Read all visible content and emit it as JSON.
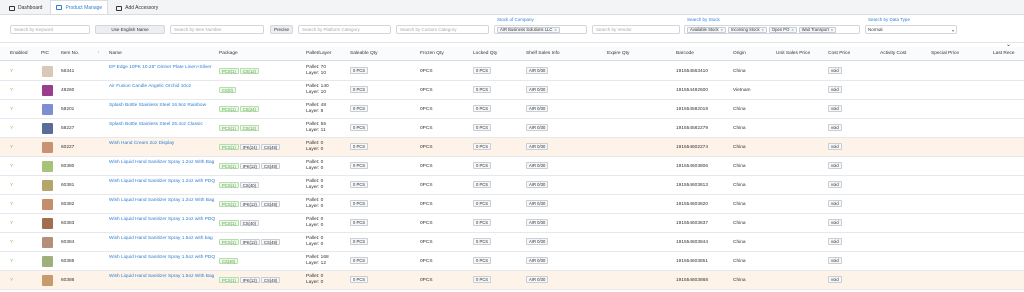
{
  "tabs": [
    {
      "label": "Dashboard",
      "icon": "dashboard-icon"
    },
    {
      "label": "Product Manage",
      "icon": "product-icon",
      "active": true
    },
    {
      "label": "Add Accessory",
      "icon": "accessory-icon"
    }
  ],
  "filters": {
    "keyword_placeholder": "Search by Keyword",
    "use_english_name": "Use English Name",
    "item_number_placeholder": "Search by Item Number",
    "precise": "Precise",
    "platform_category_placeholder": "Search by Platform Category",
    "custom_category_placeholder": "Search by Custom Category",
    "stock_of_company_label": "Stock of Company",
    "stock_of_company_tag": "AIR Business Solutions LLC",
    "vendor_placeholder": "Search by Vendor",
    "search_by_stock_label": "Search by Stock",
    "stock_tags": [
      "Available Stock",
      "Incoming Stock",
      "Open PO",
      "Wait Transport"
    ],
    "data_type_label": "Search by Data Type",
    "data_type_value": "Normal"
  },
  "columns": {
    "enabled": "Enabled",
    "pic": "PIC",
    "item_no": "Item No.",
    "name": "Name",
    "package": "Package",
    "pallet_layer": "Pallet/Layer",
    "saleable_qty": "Saleable Qty",
    "frozen_qty": "Frozen Qty",
    "locked_qty": "Locked Qty",
    "shelf_sales_info": "Shelf Sales Info",
    "expire_qty": "Expire Qty",
    "barcode": "Barcode",
    "origin": "Origin",
    "unit_sales_price": "Unit Sales Price",
    "cost_price": "Cost Price",
    "activity_cost": "Activity Cost",
    "special_price": "Special Price",
    "last_recv": "Last Rece"
  },
  "rows": [
    {
      "enabled": "Y",
      "item_no": "56341",
      "name": "EP Edge 10PK 10.25\" Dinner Plate Linen+Silver",
      "package": [
        [
          "PCS(1)",
          "g"
        ],
        [
          "CS(12)",
          "g"
        ]
      ],
      "pallet": "Pallet: 70",
      "layer": "Layer: 10",
      "saleable": "0 PCS",
      "frozen": "0PCS",
      "locked": "0 PCS",
      "shelf": "AIR 0/30",
      "barcode": "191554563410",
      "origin": "China",
      "cost": "void",
      "pic_color": "#d8c9b6",
      "hl": false
    },
    {
      "enabled": "Y",
      "item_no": "48260",
      "name": "Air Fusion Candle Angelic Orchid 10oz",
      "package": [
        [
          "CS(0)",
          "g"
        ]
      ],
      "pallet": "Pallet: 140",
      "layer": "Layer: 10",
      "saleable": "0 PCS",
      "frozen": "0PCS",
      "locked": "0 PCS",
      "shelf": "AIR 0/30",
      "barcode": "191554482600",
      "origin": "Vietnam",
      "cost": "void",
      "pic_color": "#9b3d8f",
      "hl": false
    },
    {
      "enabled": "Y",
      "item_no": "58201",
      "name": "Splash Bottle Stainless Steel 16.9oz Rainbow",
      "package": [
        [
          "PCS(1)",
          "g"
        ],
        [
          "CS(24)",
          "g"
        ]
      ],
      "pallet": "Pallet: 48",
      "layer": "Layer: 8",
      "saleable": "0 PCS",
      "frozen": "0PCS",
      "locked": "0 PCS",
      "shelf": "AIR 0/30",
      "barcode": "191554582019",
      "origin": "China",
      "cost": "void",
      "pic_color": "#7d8fd0",
      "hl": false
    },
    {
      "enabled": "Y",
      "item_no": "58227",
      "name": "Splash Bottle Stainless Steel 25.4oz Classic",
      "package": [
        [
          "PCS(1)",
          "g"
        ],
        [
          "CS(12)",
          "g"
        ]
      ],
      "pallet": "Pallet: 55",
      "layer": "Layer: 11",
      "saleable": "0 PCS",
      "frozen": "0PCS",
      "locked": "0 PCS",
      "shelf": "AIR 0/30",
      "barcode": "191554582279",
      "origin": "China",
      "cost": "void",
      "pic_color": "#5a6d9a",
      "hl": false
    },
    {
      "enabled": "Y",
      "item_no": "60227",
      "name": "Wish Hand Cream 2oz Display",
      "package": [
        [
          "PCS(1)",
          "g"
        ],
        [
          "IPK(24)",
          "x"
        ],
        [
          "CS(48)",
          "x"
        ]
      ],
      "pallet": "Pallet: 0",
      "layer": "Layer: 0",
      "saleable": "0 PCS",
      "frozen": "0PCS",
      "locked": "0 PCS",
      "shelf": "AIR 0/30",
      "barcode": "191554602274",
      "origin": "China",
      "cost": "void",
      "pic_color": "#c99274",
      "hl": true
    },
    {
      "enabled": "Y",
      "item_no": "60380",
      "name": "Wish Liquid Hand Sanitizer Spray 1.2oz With Bag",
      "package": [
        [
          "PCS(1)",
          "g"
        ],
        [
          "IPK(12)",
          "x"
        ],
        [
          "CS(48)",
          "x"
        ]
      ],
      "pallet": "Pallet: 0",
      "layer": "Layer: 0",
      "saleable": "0 PCS",
      "frozen": "0PCS",
      "locked": "0 PCS",
      "shelf": "AIR 0/30",
      "barcode": "191554603806",
      "origin": "China",
      "cost": "void",
      "pic_color": "#a8c27a",
      "hl": false
    },
    {
      "enabled": "Y",
      "item_no": "60381",
      "name": "Wish Liquid Hand Sanitizer Spray 1.2oz with PDQ",
      "package": [
        [
          "PCS(1)",
          "g"
        ],
        [
          "CS(40)",
          "x"
        ]
      ],
      "pallet": "Pallet: 0",
      "layer": "Layer: 0",
      "saleable": "0 PCS",
      "frozen": "0PCS",
      "locked": "0 PCS",
      "shelf": "AIR 0/30",
      "barcode": "191554603813",
      "origin": "China",
      "cost": "void",
      "pic_color": "#b5a46b",
      "hl": false
    },
    {
      "enabled": "Y",
      "item_no": "60382",
      "name": "Wish Liquid Hand Sanitizer Spray 1.2oz With Bag",
      "package": [
        [
          "PCS(1)",
          "g"
        ],
        [
          "IPK(12)",
          "x"
        ],
        [
          "CS(48)",
          "x"
        ]
      ],
      "pallet": "Pallet: 0",
      "layer": "Layer: 0",
      "saleable": "0 PCS",
      "frozen": "0PCS",
      "locked": "0 PCS",
      "shelf": "AIR 0/30",
      "barcode": "191554603820",
      "origin": "China",
      "cost": "void",
      "pic_color": "#c28f6a",
      "hl": false
    },
    {
      "enabled": "Y",
      "item_no": "60383",
      "name": "Wish Liquid Hand Sanitizer Spray 1.2oz with PDQ",
      "package": [
        [
          "PCS(1)",
          "g"
        ],
        [
          "CS(40)",
          "x"
        ]
      ],
      "pallet": "Pallet: 0",
      "layer": "Layer: 0",
      "saleable": "0 PCS",
      "frozen": "0PCS",
      "locked": "0 PCS",
      "shelf": "AIR 0/30",
      "barcode": "191554603837",
      "origin": "China",
      "cost": "void",
      "pic_color": "#a06f52",
      "hl": false
    },
    {
      "enabled": "Y",
      "item_no": "60384",
      "name": "Wish Liquid Hand Sanitizer Spray 1.5oz with bag",
      "package": [
        [
          "PCS(1)",
          "g"
        ],
        [
          "IPK(12)",
          "x"
        ],
        [
          "CS(48)",
          "x"
        ]
      ],
      "pallet": "Pallet: 0",
      "layer": "Layer: 0",
      "saleable": "0 PCS",
      "frozen": "0PCS",
      "locked": "0 PCS",
      "shelf": "AIR 0/30",
      "barcode": "191554603844",
      "origin": "China",
      "cost": "void",
      "pic_color": "#b58f7a",
      "hl": false
    },
    {
      "enabled": "Y",
      "item_no": "60385",
      "name": "Wish Liquid Hand Sanitizer Spray 1.5oz with PDQ",
      "package": [
        [
          "CS(40)",
          "g"
        ]
      ],
      "pallet": "Pallet: 168",
      "layer": "Layer: 12",
      "saleable": "0 PCS",
      "frozen": "0PCS",
      "locked": "0 PCS",
      "shelf": "AIR 0/30",
      "barcode": "191554603851",
      "origin": "China",
      "cost": "void",
      "pic_color": "#9fb07c",
      "hl": false
    },
    {
      "enabled": "Y",
      "item_no": "60386",
      "name": "Wish Liquid Hand Sanitizer Spray 1.5oz With Bag",
      "package": [
        [
          "PCS(1)",
          "g"
        ],
        [
          "IPK(12)",
          "x"
        ],
        [
          "CS(48)",
          "x"
        ]
      ],
      "pallet": "Pallet: 0",
      "layer": "Layer: 0",
      "saleable": "0 PCS",
      "frozen": "0PCS",
      "locked": "0 PCS",
      "shelf": "AIR 0/30",
      "barcode": "191554603868",
      "origin": "China",
      "cost": "void",
      "pic_color": "#c79b6e",
      "hl": true
    }
  ]
}
